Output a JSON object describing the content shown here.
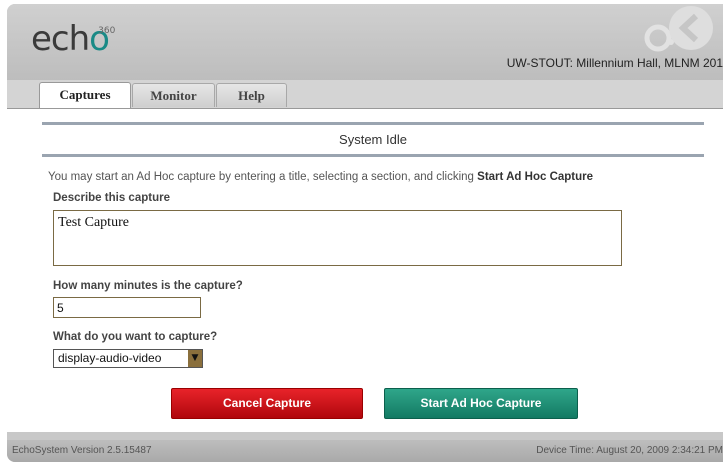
{
  "header": {
    "logo_text": "echo",
    "logo_superscript": "360",
    "location": "UW-STOUT: Millennium Hall, MLNM 201"
  },
  "tabs": [
    {
      "label": "Captures",
      "active": true
    },
    {
      "label": "Monitor",
      "active": false
    },
    {
      "label": "Help",
      "active": false
    }
  ],
  "status": {
    "text": "System Idle"
  },
  "form": {
    "intro_text": "You may start an Ad Hoc capture by entering a title, selecting a section, and clicking ",
    "intro_bold": "Start Ad Hoc Capture",
    "describe_label": "Describe this capture",
    "describe_value": "Test Capture",
    "minutes_label": "How many minutes is the capture?",
    "minutes_value": "5",
    "capture_label": "What do you want to capture?",
    "capture_value": "display-audio-video"
  },
  "buttons": {
    "cancel_label": "Cancel Capture",
    "start_label": "Start Ad Hoc Capture"
  },
  "footer": {
    "version": "EchoSystem Version 2.5.15487",
    "device_time": "Device Time: August 20, 2009 2:34:21 PM"
  },
  "colors": {
    "cancel_button": "#d0141b",
    "start_button": "#1f8f74",
    "logo_accent": "#1a8a86"
  }
}
